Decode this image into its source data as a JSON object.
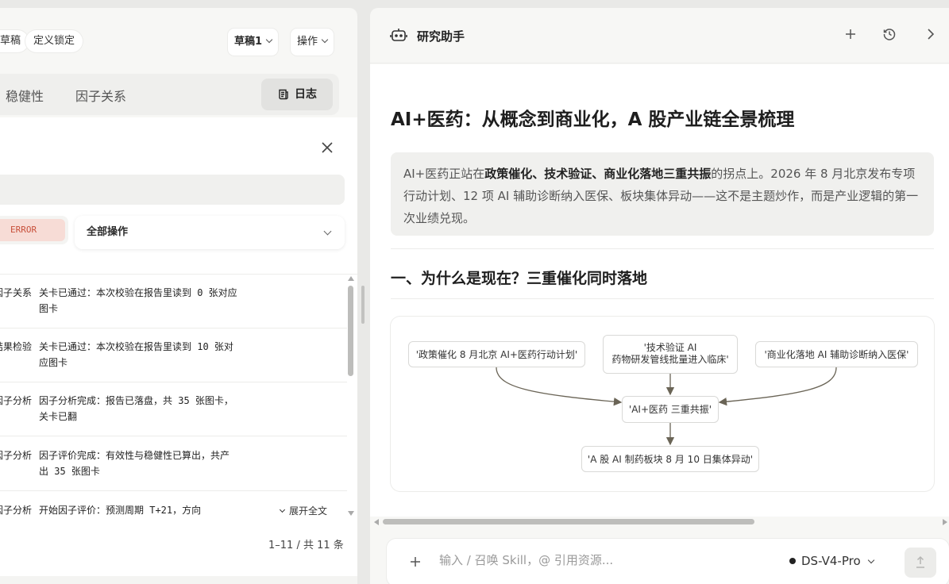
{
  "left": {
    "pills": {
      "draft_partial": "草稿",
      "lock": "定义锁定"
    },
    "draft_select": "草稿1",
    "ops_select": "操作",
    "tabs": {
      "robustness_partial": "稳健性",
      "relation": "因子关系"
    },
    "log_button": "日志",
    "filter": {
      "level": "ERROR",
      "action": "全部操作"
    },
    "rows": [
      {
        "stage": "因子关系",
        "message": "关卡已通过：本次校验在报告里读到 0 张对应图卡"
      },
      {
        "stage": "结果检验",
        "message": "关卡已通过：本次校验在报告里读到 10 张对应图卡"
      },
      {
        "stage": "因子分析",
        "message": "因子分析完成：报告已落盘，共 35 张图卡，关卡已翻"
      },
      {
        "stage": "因子分析",
        "message": "因子评价完成：有效性与稳健性已算出，共产出 35 张图卡"
      },
      {
        "stage": "因子分析",
        "message": "开始因子评价：预测周期 T+21，方向"
      }
    ],
    "expand_label": "展开全文",
    "pager": "1–11 / 共 11 条"
  },
  "right": {
    "title": "研究助手",
    "article": {
      "h1": "AI+医药：从概念到商业化，A 股产业链全景梳理",
      "quote": {
        "pre": "AI+医药正站在",
        "bold": "政策催化、技术验证、商业化落地三重共振",
        "post": "的拐点上。2026 年 8 月北京发布专项行动计划、12 项 AI 辅助诊断纳入医保、板块集体异动——这不是主题炒作，而是产业逻辑的第一次业绩兑现。"
      },
      "h2": "一、为什么是现在？三重催化同时落地"
    },
    "diagram": {
      "nodes": {
        "policy": "'政策催化 8 月北京 AI+医药行动计划'",
        "tech_line1": "'技术验证 AI",
        "tech_line2": "药物研发管线批量进入临床'",
        "commercial": "'商业化落地 AI 辅助诊断纳入医保'",
        "resonance": "'AI+医药 三重共振'",
        "result": "'A 股 AI 制药板块 8 月 10 日集体异动'"
      }
    },
    "input": {
      "placeholder": "输入 / 召唤 Skill，@ 引用资源..."
    },
    "model": "DS-V4-Pro"
  }
}
